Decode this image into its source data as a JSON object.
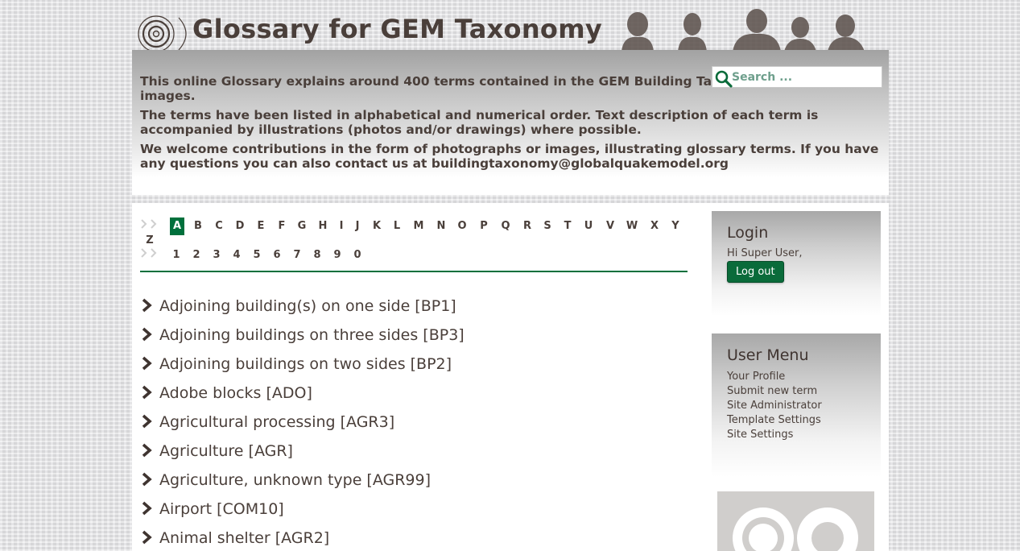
{
  "header": {
    "site_title": "Glossary for GEM Taxonomy"
  },
  "search": {
    "placeholder": "Search ..."
  },
  "intro": {
    "paragraphs": [
      "This online Glossary explains around 400 terms contained in the GEM Building Taxonomy and nearly 700 images.",
      "The terms have been listed in alphabetical and numerical order. Text description of each term is accompanied by illustrations (photos and/or drawings) where possible.",
      "We welcome contributions in the form of photographs or images, illustrating glossary terms. If you have any questions you can also contact us at buildingtaxonomy@globalquakemodel.org"
    ]
  },
  "alpha_nav": {
    "active": "A",
    "letters": [
      "A",
      "B",
      "C",
      "D",
      "E",
      "F",
      "G",
      "H",
      "I",
      "J",
      "K",
      "L",
      "M",
      "N",
      "O",
      "P",
      "Q",
      "R",
      "S",
      "T",
      "U",
      "V",
      "W",
      "X",
      "Y",
      "Z"
    ],
    "numbers": [
      "1",
      "2",
      "3",
      "4",
      "5",
      "6",
      "7",
      "8",
      "9",
      "0"
    ]
  },
  "terms": [
    "Adjoining building(s) on one side [BP1]",
    "Adjoining buildings on three sides [BP3]",
    "Adjoining buildings on two sides [BP2]",
    "Adobe blocks [ADO]",
    "Agricultural processing [AGR3]",
    "Agriculture [AGR]",
    "Agriculture, unknown type [AGR99]",
    "Airport [COM10]",
    "Animal shelter [AGR2]"
  ],
  "login": {
    "title": "Login",
    "greeting": "Hi Super User,",
    "logout_label": "Log out"
  },
  "user_menu": {
    "title": "User Menu",
    "items": [
      "Your Profile",
      "Submit new term",
      "Site Administrator",
      "Template Settings",
      "Site Settings"
    ]
  },
  "colors": {
    "accent": "#00703c",
    "text": "#4a3f3a"
  }
}
